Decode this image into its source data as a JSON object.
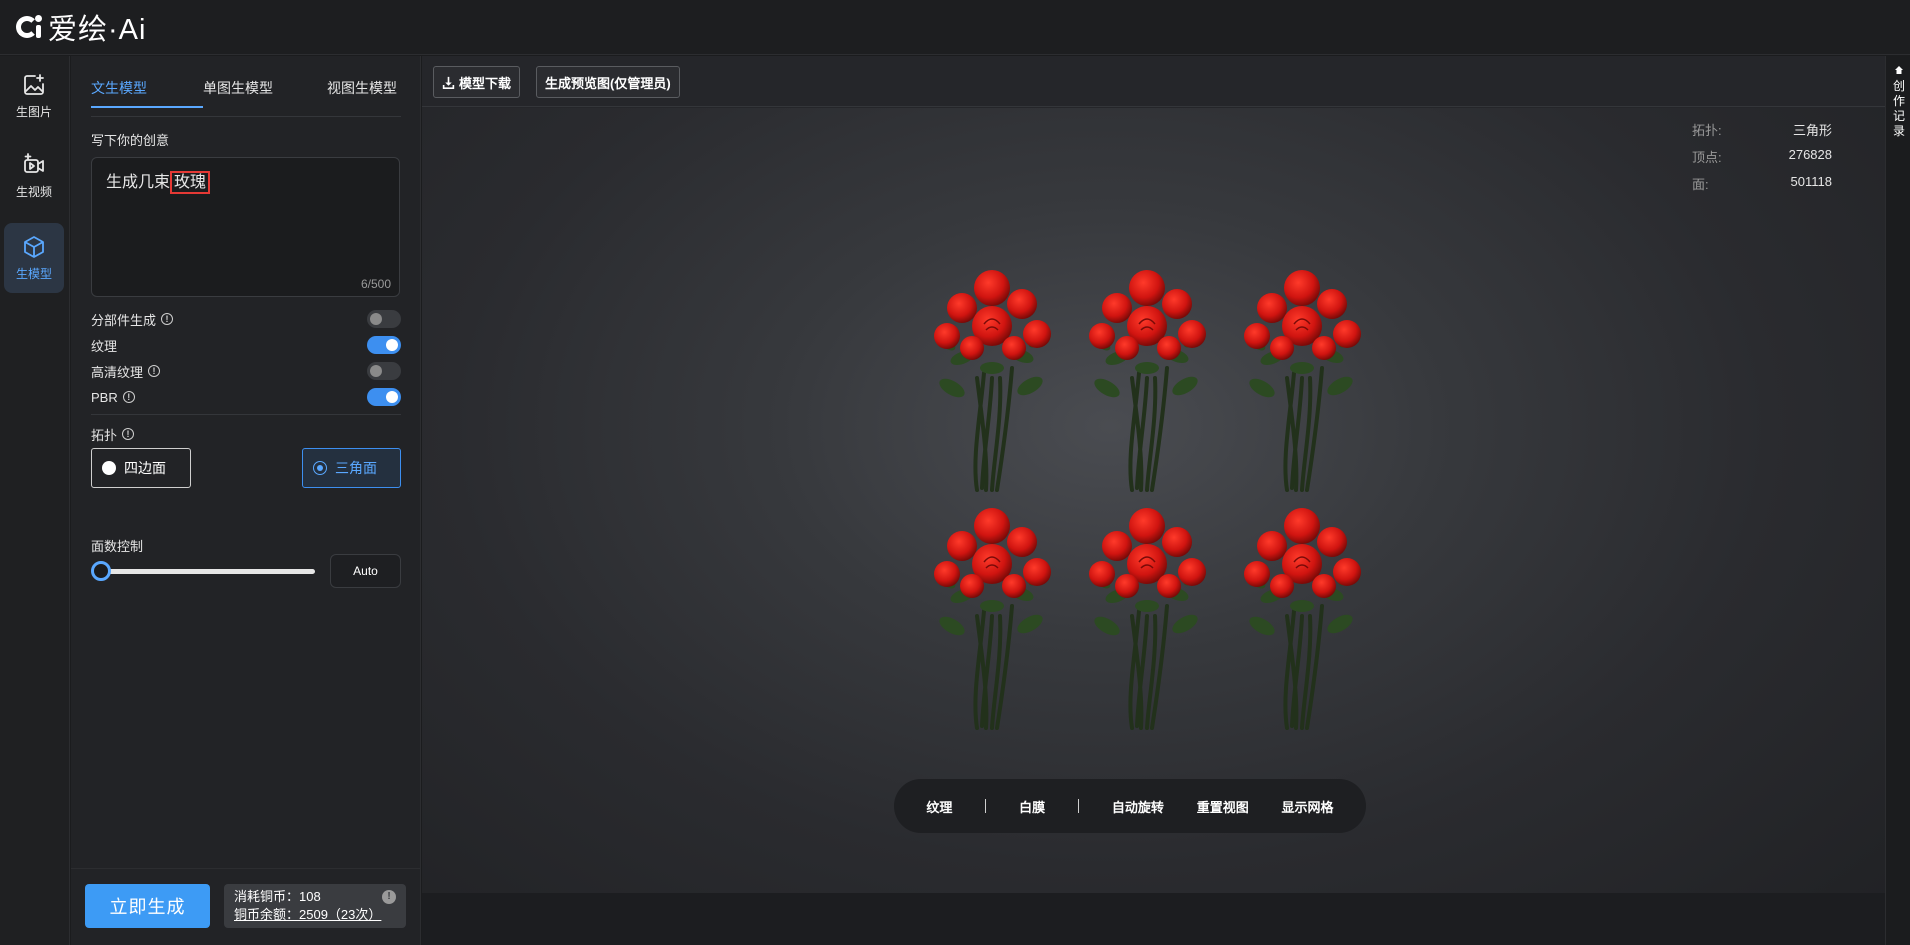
{
  "app": {
    "logo_text": "爱绘·Ai"
  },
  "rail": {
    "items": [
      {
        "label": "生图片",
        "icon": "image-plus-icon"
      },
      {
        "label": "生视频",
        "icon": "video-plus-icon"
      },
      {
        "label": "生模型",
        "icon": "cube-icon",
        "active": true
      }
    ]
  },
  "panel": {
    "tabs": [
      {
        "label": "文生模型",
        "active": true
      },
      {
        "label": "单图生模型"
      },
      {
        "label": "视图生模型"
      }
    ],
    "prompt_label": "写下你的创意",
    "prompt_prefix": "生成几束",
    "prompt_highlight": "玫瑰",
    "prompt_counter": "6/500",
    "options": [
      {
        "label": "分部件生成",
        "info": true,
        "on": false
      },
      {
        "label": "纹理",
        "info": false,
        "on": true
      },
      {
        "label": "高清纹理",
        "info": true,
        "on": false
      },
      {
        "label": "PBR",
        "info": true,
        "on": true
      }
    ],
    "topology_label": "拓扑",
    "topology_options": [
      {
        "label": "四边面",
        "selected": false
      },
      {
        "label": "三角面",
        "selected": true
      }
    ],
    "face_control_label": "面数控制",
    "face_slider_value": 0,
    "auto_label": "Auto",
    "generate_label": "立即生成",
    "cost_line": "消耗铜币：108",
    "balance_line": "铜币余额：2509（23次）"
  },
  "main": {
    "download_label": "模型下载",
    "preview_label": "生成预览图(仅管理员)",
    "stats": [
      {
        "label": "拓扑:",
        "value": "三角形"
      },
      {
        "label": "顶点:",
        "value": "276828"
      },
      {
        "label": "面:",
        "value": "501118"
      }
    ],
    "view_controls": [
      "纹理",
      "白膜",
      "自动旋转",
      "重置视图",
      "显示网格"
    ]
  },
  "right_strip": {
    "label": "创作记录"
  },
  "colors": {
    "accent": "#3d9bf5",
    "rose": "#d61a12",
    "stem": "#24331c"
  }
}
